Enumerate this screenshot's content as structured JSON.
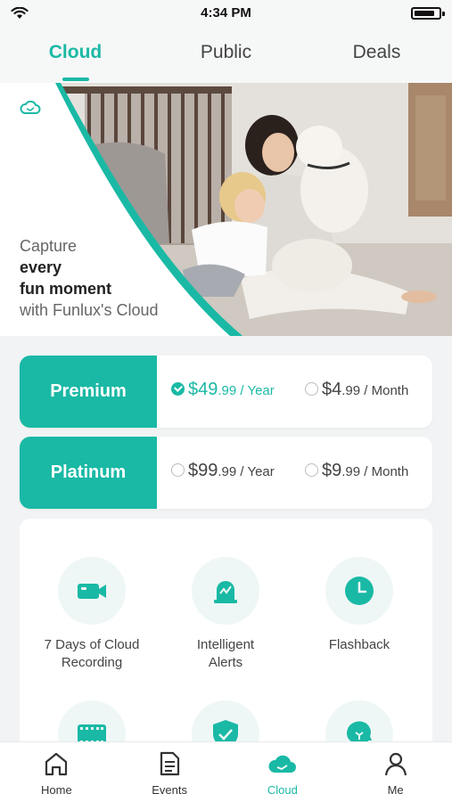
{
  "status_bar": {
    "time": "4:34 PM"
  },
  "top_tabs": [
    {
      "label": "Cloud",
      "active": true
    },
    {
      "label": "Public",
      "active": false
    },
    {
      "label": "Deals",
      "active": false
    }
  ],
  "hero": {
    "line1": "Capture",
    "line2": "every",
    "line3": "fun moment",
    "line4": "with Funlux's Cloud"
  },
  "plans": [
    {
      "name": "Premium",
      "options": [
        {
          "dollars": "$49",
          "cents": ".99",
          "period": " / Year",
          "selected": true
        },
        {
          "dollars": "$4",
          "cents": ".99",
          "period": " / Month",
          "selected": false
        }
      ]
    },
    {
      "name": "Platinum",
      "options": [
        {
          "dollars": "$99",
          "cents": ".99",
          "period": " / Year",
          "selected": false
        },
        {
          "dollars": "$9",
          "cents": ".99",
          "period": " / Month",
          "selected": false
        }
      ]
    }
  ],
  "features": [
    {
      "line1": "7 Days of Cloud",
      "line2": "Recording",
      "icon": "video-camera-icon"
    },
    {
      "line1": "Intelligent",
      "line2": "Alerts",
      "icon": "alert-bell-icon"
    },
    {
      "line1": "Flashback",
      "line2": "",
      "icon": "clock-icon"
    },
    {
      "line1": "",
      "line2": "",
      "icon": "film-strip-icon"
    },
    {
      "line1": "",
      "line2": "",
      "icon": "shield-check-icon"
    },
    {
      "line1": "",
      "line2": "",
      "icon": "head-idea-icon"
    }
  ],
  "bottom_nav": [
    {
      "label": "Home",
      "icon": "home-icon",
      "active": false
    },
    {
      "label": "Events",
      "icon": "document-icon",
      "active": false
    },
    {
      "label": "Cloud",
      "icon": "cloud-icon",
      "active": true
    },
    {
      "label": "Me",
      "icon": "person-icon",
      "active": false
    }
  ],
  "colors": {
    "accent": "#1ab9a5",
    "background": "#f2f3f4"
  }
}
